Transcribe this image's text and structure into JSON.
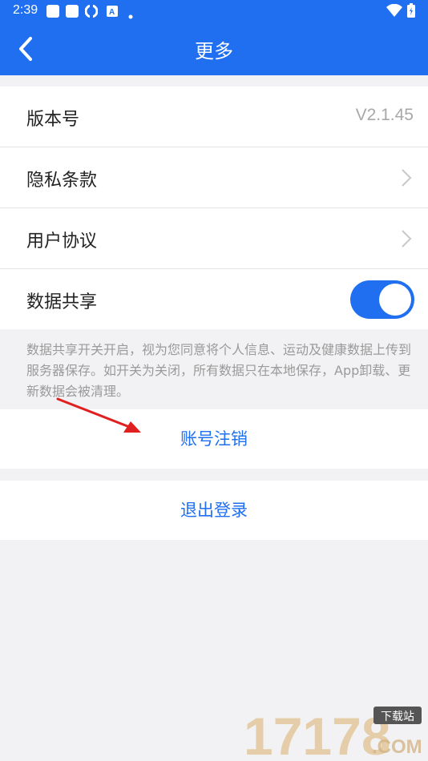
{
  "status_bar": {
    "time": "2:39",
    "icons": [
      "notification-icon",
      "notification-icon",
      "sync-icon",
      "a-icon",
      "dot-icon"
    ],
    "right_icons": [
      "wifi-icon",
      "battery-icon"
    ]
  },
  "header": {
    "title": "更多",
    "back_icon": "back-arrow-icon"
  },
  "settings": {
    "version": {
      "label": "版本号",
      "value": "V2.1.45"
    },
    "privacy": {
      "label": "隐私条款"
    },
    "agreement": {
      "label": "用户协议"
    },
    "data_share": {
      "label": "数据共享",
      "enabled": true
    }
  },
  "note": "数据共享开关开启，视为您同意将个人信息、运动及健康数据上传到服务器保存。如开关为关闭，所有数据只在本地保存，App卸载、更新数据会被清理。",
  "actions": {
    "cancel_account": "账号注销",
    "logout": "退出登录"
  },
  "watermark": {
    "number": "17178",
    "site": "下载站",
    "domain": ".COM"
  },
  "colors": {
    "primary": "#1f6ff0",
    "background": "#f2f2f4",
    "annotation_arrow": "#e02020"
  }
}
